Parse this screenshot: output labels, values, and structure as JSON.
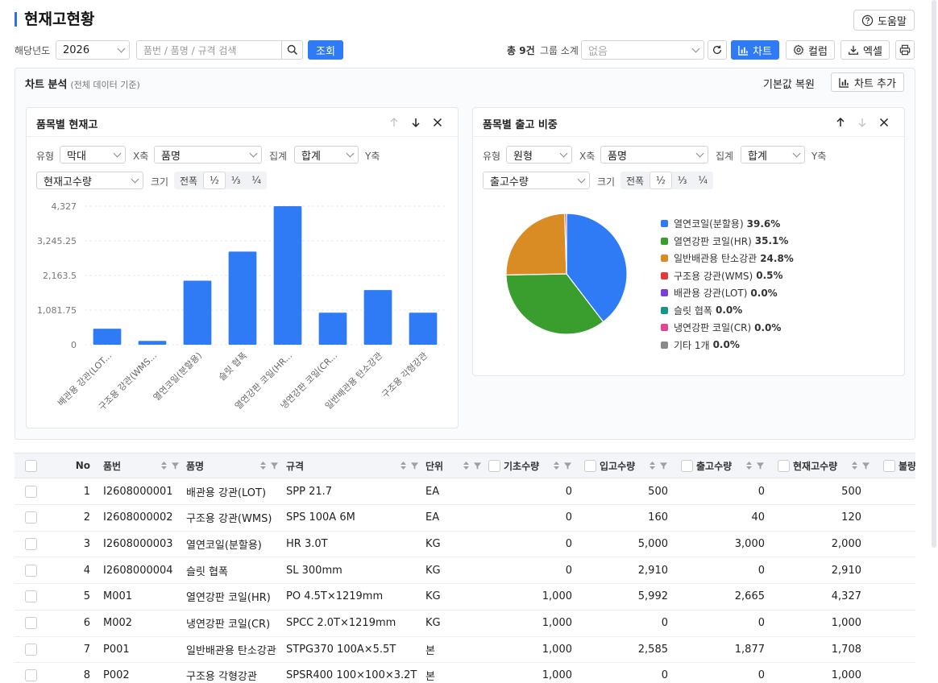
{
  "page": {
    "title": "현재고현황",
    "help_label": "도움말"
  },
  "toolbar": {
    "year_label": "해당년도",
    "year_value": "2026",
    "search_placeholder": "품번 / 품명 / 규격 검색",
    "query_label": "조회",
    "total_label": "총 9건",
    "group_label": "그룹 소계",
    "group_placeholder": "없음",
    "chart_label": "차트",
    "column_label": "컬럼",
    "excel_label": "엑셀"
  },
  "chart_section": {
    "title": "차트 분석",
    "subtitle": "(전체 데이터 기준)",
    "reset_label": "기본값 복원",
    "add_label": "차트 추가"
  },
  "controls": {
    "type_label": "유형",
    "x_label": "X축",
    "agg_label": "집계",
    "y_label": "Y축",
    "size_label": "크기",
    "size_options": [
      "전폭",
      "½",
      "⅓",
      "¼"
    ]
  },
  "bar_panel": {
    "title": "품목별 현재고",
    "type_value": "막대",
    "x_value": "품명",
    "agg_value": "합계",
    "y_value": "현재고수량",
    "size_selected": "½"
  },
  "pie_panel": {
    "title": "품목별 출고 비중",
    "type_value": "원형",
    "x_value": "품명",
    "agg_value": "합계",
    "y_value": "출고수량",
    "size_selected": "½"
  },
  "chart_data": [
    {
      "type": "bar",
      "title": "품목별 현재고",
      "categories": [
        "배관용 강관(LOT...",
        "구조용 강관(WMS...",
        "열연코일(분할용)",
        "슬릿 협폭",
        "열연강판 코일(HR...",
        "냉연강판 코일(CR...",
        "일반배관용 탄소강관",
        "구조용 각형강관"
      ],
      "values": [
        500,
        120,
        2000,
        2910,
        4327,
        1000,
        1708,
        1000
      ],
      "yticks": [
        "0",
        "1,081.75",
        "2,163.5",
        "3,245.25",
        "4,327"
      ],
      "ylim": [
        0,
        4327
      ],
      "grid": true,
      "color": "#2f7bf5"
    },
    {
      "type": "pie",
      "title": "품목별 출고 비중",
      "slices": [
        {
          "label": "열연코일(분할용)",
          "pct_label": "39.6%",
          "value": 39.6,
          "color": "#2f7bf5"
        },
        {
          "label": "열연강판 코일(HR)",
          "pct_label": "35.1%",
          "value": 35.1,
          "color": "#3a9e2f"
        },
        {
          "label": "일반배관용 탄소강관",
          "pct_label": "24.8%",
          "value": 24.8,
          "color": "#d98c24"
        },
        {
          "label": "구조용 강관(WMS)",
          "pct_label": "0.5%",
          "value": 0.5,
          "color": "#e03b3b"
        },
        {
          "label": "배관용 강관(LOT)",
          "pct_label": "0.0%",
          "value": 0.0,
          "color": "#7b3fd1"
        },
        {
          "label": "슬릿 협폭",
          "pct_label": "0.0%",
          "value": 0.0,
          "color": "#16958f"
        },
        {
          "label": "냉연강판 코일(CR)",
          "pct_label": "0.0%",
          "value": 0.0,
          "color": "#e04594"
        },
        {
          "label": "기타 1개",
          "pct_label": "0.0%",
          "value": 0.0,
          "color": "#8a8a8a"
        }
      ],
      "legend": "right"
    }
  ],
  "table": {
    "headers": {
      "no": "No",
      "code": "품번",
      "name": "품명",
      "spec": "규격",
      "unit": "단위",
      "base": "기초수량",
      "in": "입고수량",
      "out": "출고수량",
      "stock": "현재고수량",
      "bad": "불량"
    },
    "rows": [
      {
        "no": "1",
        "code": "I2608000001",
        "name": "배관용 강관(LOT)",
        "spec": "SPP 21.7",
        "unit": "EA",
        "base": "0",
        "in": "500",
        "out": "0",
        "stock": "500"
      },
      {
        "no": "2",
        "code": "I2608000002",
        "name": "구조용 강관(WMS)",
        "spec": "SPS 100A 6M",
        "unit": "EA",
        "base": "0",
        "in": "160",
        "out": "40",
        "stock": "120"
      },
      {
        "no": "3",
        "code": "I2608000003",
        "name": "열연코일(분할용)",
        "spec": "HR 3.0T",
        "unit": "KG",
        "base": "0",
        "in": "5,000",
        "out": "3,000",
        "stock": "2,000"
      },
      {
        "no": "4",
        "code": "I2608000004",
        "name": "슬릿 협폭",
        "spec": "SL 300mm",
        "unit": "KG",
        "base": "0",
        "in": "2,910",
        "out": "0",
        "stock": "2,910"
      },
      {
        "no": "5",
        "code": "M001",
        "name": "열연강판 코일(HR)",
        "spec": "PO 4.5T×1219mm",
        "unit": "KG",
        "base": "1,000",
        "in": "5,992",
        "out": "2,665",
        "stock": "4,327"
      },
      {
        "no": "6",
        "code": "M002",
        "name": "냉연강판 코일(CR)",
        "spec": "SPCC 2.0T×1219mm",
        "unit": "KG",
        "base": "1,000",
        "in": "0",
        "out": "0",
        "stock": "1,000"
      },
      {
        "no": "7",
        "code": "P001",
        "name": "일반배관용 탄소강관",
        "spec": "STPG370 100A×5.5T",
        "unit": "본",
        "base": "1,000",
        "in": "2,585",
        "out": "1,877",
        "stock": "1,708"
      },
      {
        "no": "8",
        "code": "P002",
        "name": "구조용 각형강관",
        "spec": "SPSR400 100×100×3.2T",
        "unit": "본",
        "base": "1,000",
        "in": "0",
        "out": "0",
        "stock": "1,000"
      }
    ]
  }
}
